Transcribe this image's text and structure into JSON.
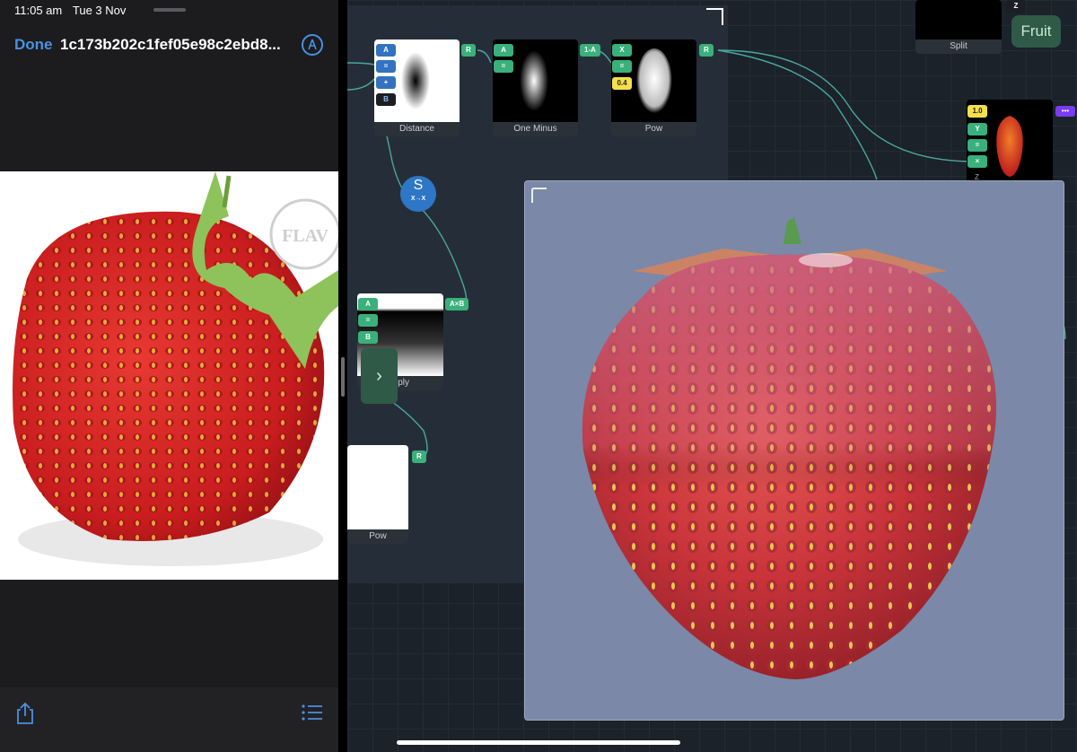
{
  "status_bar": {
    "time": "11:05 am",
    "date": "Tue 3 Nov"
  },
  "viewer": {
    "done_label": "Done",
    "file_name": "1c173b202c1fef05e98c2ebd8...",
    "icons": {
      "markup": "markup-icon",
      "share": "share-icon",
      "list": "list-icon"
    },
    "photo_watermark": "FLAV WEST"
  },
  "graph": {
    "nodes": {
      "distance": {
        "title": "Distance",
        "inputs": [
          "A",
          "=",
          "+",
          "B"
        ],
        "output": "R"
      },
      "one_minus": {
        "title": "One Minus",
        "inputs": [
          "A",
          "="
        ],
        "output": "1-A"
      },
      "pow_top": {
        "title": "Pow",
        "inputs": [
          "X",
          "=",
          "0.4"
        ],
        "output": "R"
      },
      "multiply": {
        "title": "ltiply",
        "inputs": [
          "A",
          "=",
          "B"
        ],
        "output": "A×B"
      },
      "pow_bottom": {
        "title": "Pow",
        "output": "R"
      },
      "split": {
        "title": "Split",
        "inputs": [
          "Z"
        ]
      },
      "combine": {
        "inputs": [
          "1.0",
          "Y",
          "=",
          "×"
        ],
        "extra": "Z"
      }
    },
    "swizzle_label": "X→X",
    "fruit_button": "Fruit",
    "expand_glyph": "›"
  }
}
